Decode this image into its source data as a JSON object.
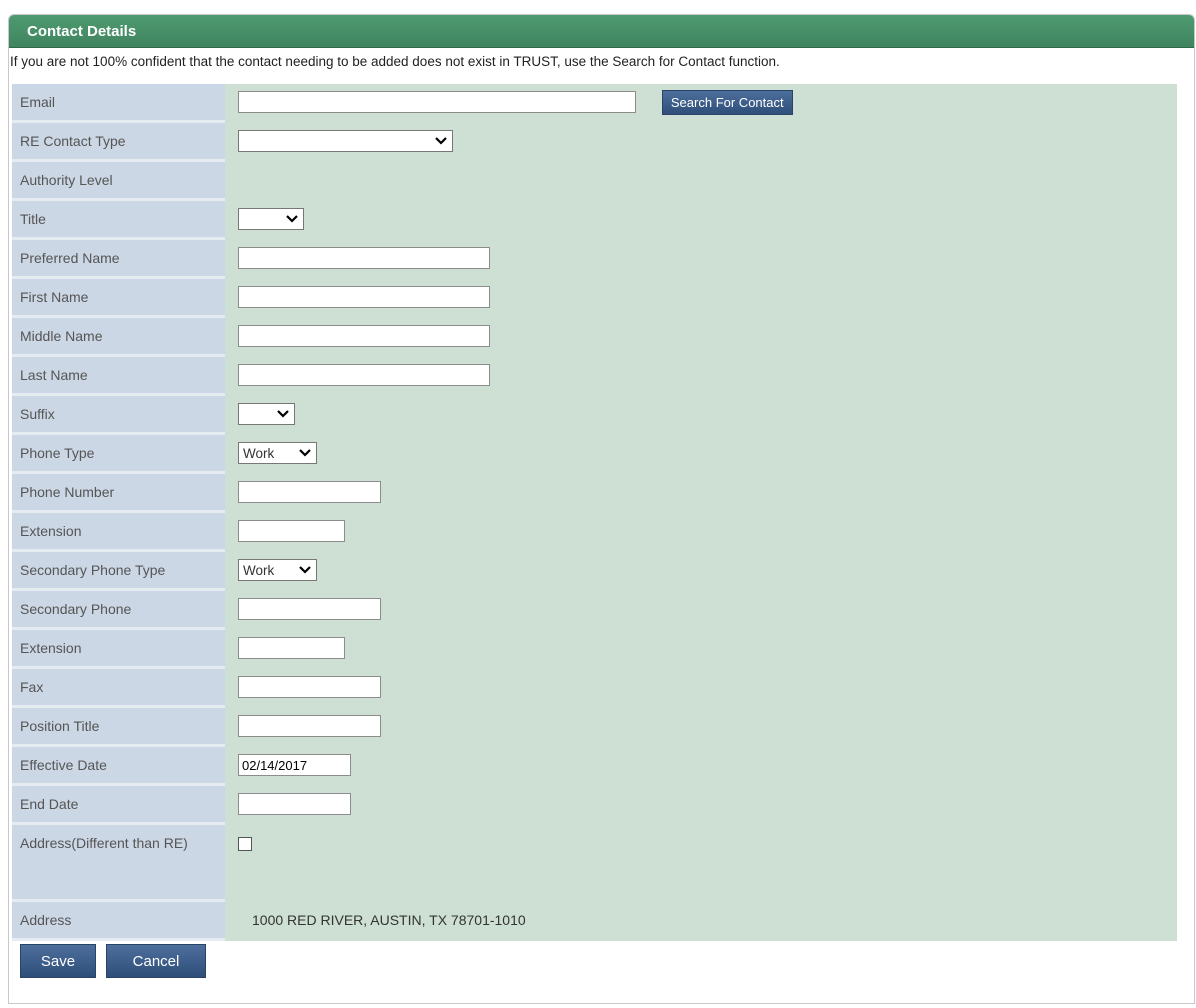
{
  "header": {
    "title": "Contact Details"
  },
  "notice": "If you are not 100% confident that the contact needing to be added does not exist in TRUST, use the Search for Contact function.",
  "fields": {
    "email": {
      "label": "Email",
      "value": ""
    },
    "search_button": "Search For Contact",
    "re_contact_type": {
      "label": "RE Contact Type",
      "selected": ""
    },
    "authority_level": {
      "label": "Authority Level"
    },
    "title": {
      "label": "Title",
      "selected": ""
    },
    "preferred_name": {
      "label": "Preferred Name",
      "value": ""
    },
    "first_name": {
      "label": "First Name",
      "value": ""
    },
    "middle_name": {
      "label": "Middle Name",
      "value": ""
    },
    "last_name": {
      "label": "Last Name",
      "value": ""
    },
    "suffix": {
      "label": "Suffix",
      "selected": ""
    },
    "phone_type": {
      "label": "Phone Type",
      "selected": "Work"
    },
    "phone_number": {
      "label": "Phone Number",
      "value": ""
    },
    "extension": {
      "label": "Extension",
      "value": ""
    },
    "secondary_phone_type": {
      "label": "Secondary Phone Type",
      "selected": "Work"
    },
    "secondary_phone": {
      "label": "Secondary Phone",
      "value": ""
    },
    "secondary_extension": {
      "label": "Extension",
      "value": ""
    },
    "fax": {
      "label": "Fax",
      "value": ""
    },
    "position_title": {
      "label": "Position Title",
      "value": ""
    },
    "effective_date": {
      "label": "Effective Date",
      "value": "02/14/2017"
    },
    "end_date": {
      "label": "End Date",
      "value": ""
    },
    "address_different": {
      "label": "Address(Different than RE)",
      "checked": false
    },
    "address": {
      "label": "Address",
      "value": "1000 RED RIVER, AUSTIN, TX 78701-1010"
    }
  },
  "buttons": {
    "save": "Save",
    "cancel": "Cancel"
  },
  "colors": {
    "header": "#3f8560",
    "label_bg": "#ccd7e5",
    "value_bg": "#cde0d3",
    "button": "#2f4f7a"
  }
}
